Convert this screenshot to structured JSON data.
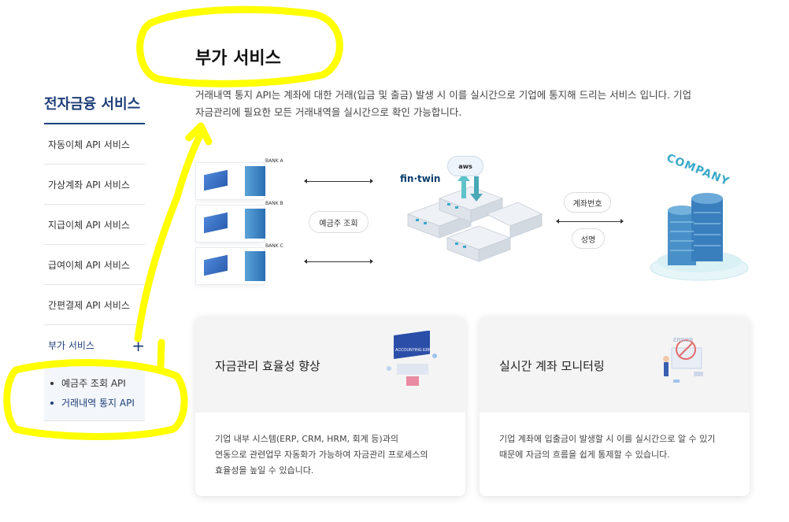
{
  "sidebar": {
    "title": "전자금융 서비스",
    "items": [
      {
        "label": "자동이체 API 서비스"
      },
      {
        "label": "가상계좌 API 서비스"
      },
      {
        "label": "지급이체 API 서비스"
      },
      {
        "label": "급여이체 API 서비스"
      },
      {
        "label": "간편결제 API 서비스"
      },
      {
        "label": "부가 서비스"
      }
    ],
    "expand_icon": "+",
    "subitems": [
      {
        "label": "예금주 조회 API"
      },
      {
        "label": "거래내역 통지 API"
      }
    ]
  },
  "main": {
    "title": "부가 서비스",
    "description_line1": "거래내역 통지 API는 계좌에 대한 거래(입금 및 출금) 발생 시 이를 실시간으로 기업에 통지해 드리는 서비스 입니다. 기업",
    "description_line2": "자금관리에 필요한 모든 거래내역을 실시간으로 확인 가능합니다."
  },
  "diagram": {
    "banks": [
      "BANK A",
      "BANK B",
      "BANK C"
    ],
    "center_label": "예금주 조회",
    "brand": "fin·twin",
    "cloud_label": "aws",
    "right_pill_top": "계좌번호",
    "right_pill_bottom": "성명",
    "company": "COMPANY"
  },
  "cards": [
    {
      "title": "자금관리 효율성 향상",
      "body_line1": "기업 내부 시스템(ERP, CRM, HRM, 회계 등)과의",
      "body_line2": "연동으로 관련업무 자동화가 가능하여 자금관리 프로세스의",
      "body_line3": "효율성을 높일 수 있습니다.",
      "illustration_text": "ACCOUNTING ERP"
    },
    {
      "title": "실시간 계좌 모니터링",
      "body_line1": "기업 계좌에 입출금이 발생할 시 이를 실시간으로 알 수 있기",
      "body_line2": "때문에 자금의 흐름을 쉽게 통제할 수 있습니다.",
      "illustration_text": "ERROR"
    }
  ],
  "colors": {
    "brand_navy": "#1f3f78",
    "annotation_yellow": "#ffff00",
    "accent_teal": "#3ca9c9"
  }
}
